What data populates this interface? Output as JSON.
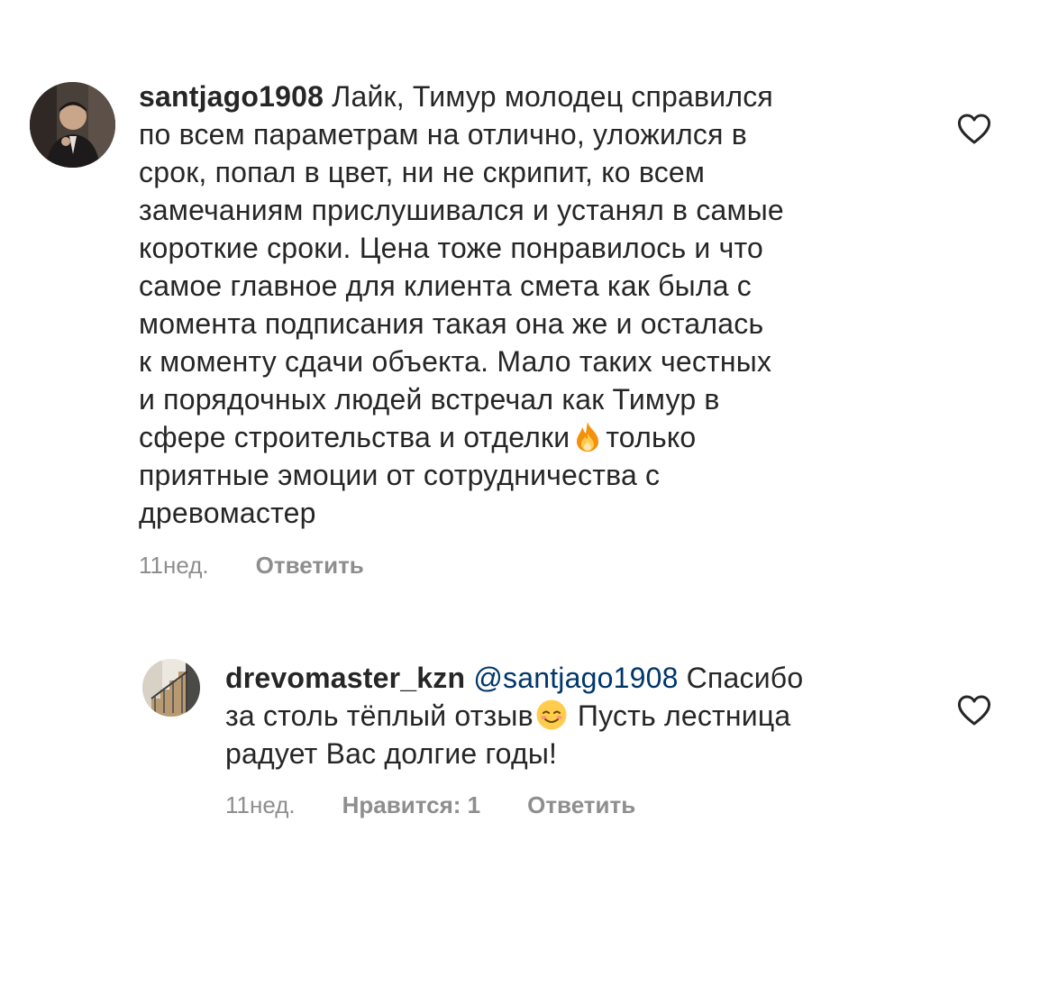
{
  "comments": [
    {
      "username": "santjago1908",
      "lines": [
        " Лайк, Тимур молодец справился",
        "по всем параметрам на отлично, уложился в",
        "срок, попал в цвет, ни не скрипит, ко всем",
        "замечаниям прислушивался и устанял в самые",
        "короткие сроки. Цена тоже понравилось и что",
        "самое главное для клиента смета как была с",
        "момента подписания такая она же и осталась",
        "к моменту сдачи объекта. Мало таких честных",
        "и порядочных людей встречал как Тимур в"
      ],
      "line_with_emoji_before": "сфере строительства и отделки",
      "line_with_emoji_after": "только",
      "lines_after": [
        "приятные эмоции от сотрудничества с",
        "древомастер"
      ],
      "emoji": "fire-emoji",
      "time": "11нед.",
      "reply_label": "Ответить"
    },
    {
      "username": "drevomaster_kzn",
      "mention": "@santjago1908",
      "line1_rest": " Спасибо",
      "line2_before": "за столь тёплый отзыв",
      "line2_after": " Пусть лестница",
      "line3": "радует Вас долгие годы!",
      "emoji": "smiling-face-emoji",
      "time": "11нед.",
      "likes_label": "Нравится: 1",
      "reply_label": "Ответить"
    }
  ],
  "colors": {
    "text": "#262626",
    "secondary": "#8e8e8e",
    "mention": "#00376b",
    "background": "#ffffff"
  }
}
